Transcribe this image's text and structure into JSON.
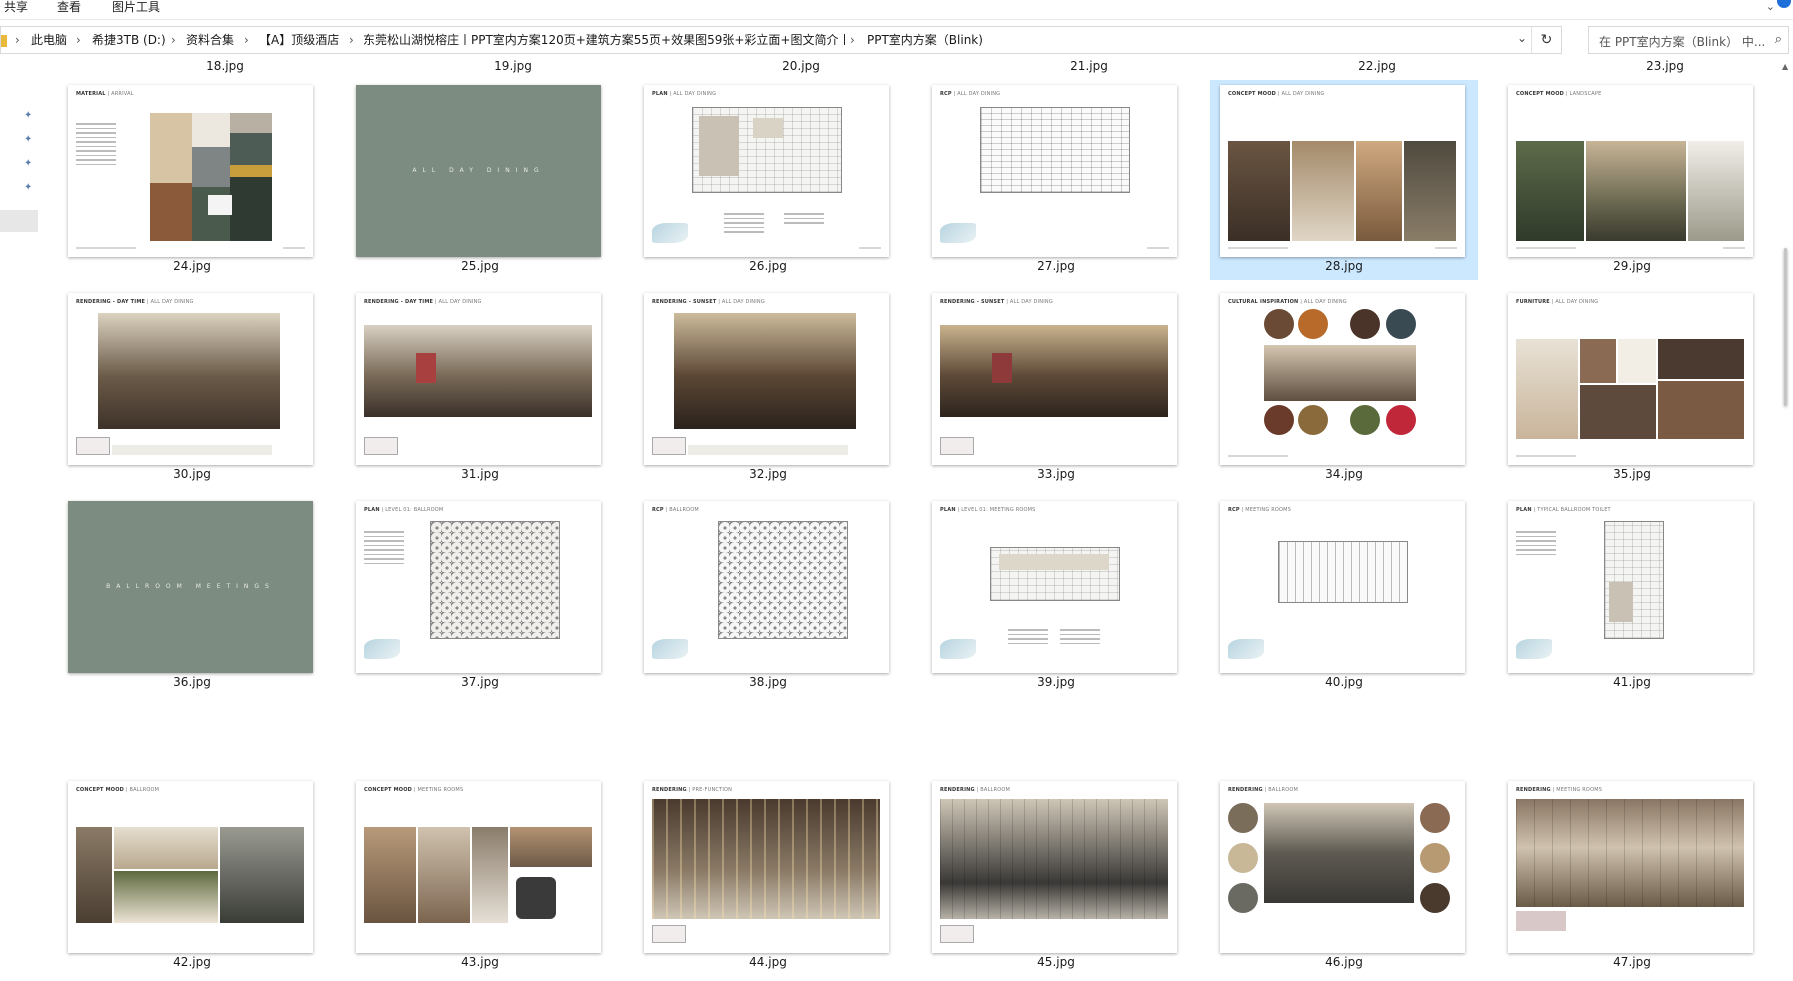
{
  "ribbon": {
    "tabs": [
      "共享",
      "查看",
      "图片工具"
    ]
  },
  "address_bar": {
    "crumbs": [
      "此电脑",
      "希捷3TB (D:)",
      "资料合集",
      "【A】顶级酒店",
      "东莞松山湖悦榕庄丨PPT室内方案120页+建筑方案55页+效果图59张+彩立面+图文简介丨",
      "PPT室内方案（Blink)"
    ],
    "search_placeholder": "在 PPT室内方案（Blink） 中...",
    "separator": "›",
    "dropdown_glyph": "⌄",
    "refresh_glyph": "↻",
    "search_glyph": "⌕"
  },
  "partial_row": [
    "18.jpg",
    "19.jpg",
    "20.jpg",
    "21.jpg",
    "22.jpg",
    "23.jpg"
  ],
  "files": [
    {
      "name": "24.jpg",
      "title": "MATERIAL",
      "subtitle": "ARRIVAL"
    },
    {
      "name": "25.jpg",
      "word": "ALL DAY DINING"
    },
    {
      "name": "26.jpg",
      "title": "PLAN",
      "subtitle": "ALL DAY DINING"
    },
    {
      "name": "27.jpg",
      "title": "RCP",
      "subtitle": "ALL DAY DINING"
    },
    {
      "name": "28.jpg",
      "title": "CONCEPT MOOD",
      "subtitle": "ALL DAY DINING",
      "selected": true
    },
    {
      "name": "29.jpg",
      "title": "CONCEPT MOOD",
      "subtitle": "LANDSCAPE"
    },
    {
      "name": "30.jpg",
      "title": "RENDERING - DAY TIME",
      "subtitle": "ALL DAY DINING"
    },
    {
      "name": "31.jpg",
      "title": "RENDERING - DAY TIME",
      "subtitle": "ALL DAY DINING"
    },
    {
      "name": "32.jpg",
      "title": "RENDERING - SUNSET",
      "subtitle": "ALL DAY DINING"
    },
    {
      "name": "33.jpg",
      "title": "RENDERING - SUNSET",
      "subtitle": "ALL DAY DINING"
    },
    {
      "name": "34.jpg",
      "title": "CULTURAL INSPIRATION",
      "subtitle": "ALL DAY DINING"
    },
    {
      "name": "35.jpg",
      "title": "FURNITURE",
      "subtitle": "ALL DAY DINING"
    },
    {
      "name": "36.jpg",
      "word": "BALLROOM MEETINGS"
    },
    {
      "name": "37.jpg",
      "title": "PLAN",
      "subtitle": "LEVEL 01: BALLROOM"
    },
    {
      "name": "38.jpg",
      "title": "RCP",
      "subtitle": "BALLROOM"
    },
    {
      "name": "39.jpg",
      "title": "PLAN",
      "subtitle": "LEVEL 01: MEETING ROOMS"
    },
    {
      "name": "40.jpg",
      "title": "RCP",
      "subtitle": "MEETING ROOMS"
    },
    {
      "name": "41.jpg",
      "title": "PLAN",
      "subtitle": "TYPICAL BALLROOM TOILET"
    },
    {
      "name": "42.jpg",
      "title": "CONCEPT MOOD",
      "subtitle": "BALLROOM"
    },
    {
      "name": "43.jpg",
      "title": "CONCEPT MOOD",
      "subtitle": "MEETING ROOMS"
    },
    {
      "name": "44.jpg",
      "title": "RENDERING",
      "subtitle": "PRE-FUNCTION"
    },
    {
      "name": "45.jpg",
      "title": "RENDERING",
      "subtitle": "BALLROOM"
    },
    {
      "name": "46.jpg",
      "title": "RENDERING",
      "subtitle": "BALLROOM"
    },
    {
      "name": "47.jpg",
      "title": "RENDERING",
      "subtitle": "MEETING ROOMS"
    }
  ],
  "colors": {
    "selection": "#cce8ff",
    "slide_green": "#7d8c80",
    "accent": "#1e6fd9"
  }
}
